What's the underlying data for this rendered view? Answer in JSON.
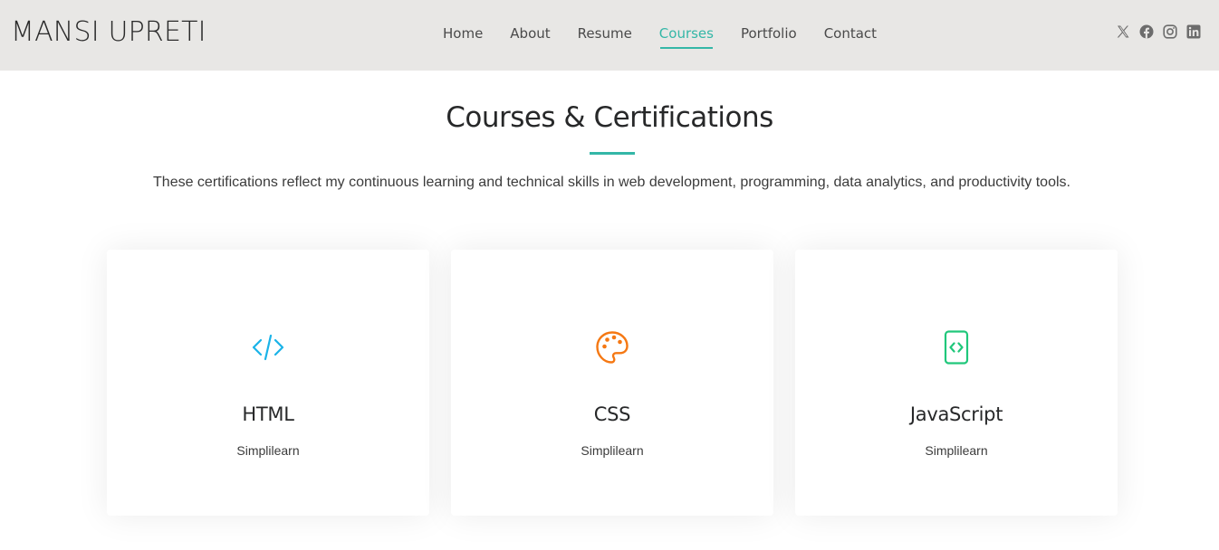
{
  "header": {
    "logo": "MANSI UPRETI",
    "nav": [
      {
        "label": "Home",
        "active": false
      },
      {
        "label": "About",
        "active": false
      },
      {
        "label": "Resume",
        "active": false
      },
      {
        "label": "Courses",
        "active": true
      },
      {
        "label": "Portfolio",
        "active": false
      },
      {
        "label": "Contact",
        "active": false
      }
    ],
    "socials": [
      "x-icon",
      "facebook-icon",
      "instagram-icon",
      "linkedin-icon"
    ]
  },
  "section": {
    "title": "Courses & Certifications",
    "description": "These certifications reflect my continuous learning and technical skills in web development, programming, data analytics, and productivity tools."
  },
  "cards": [
    {
      "title": "HTML",
      "provider": "Simplilearn",
      "icon": "code-icon",
      "icon_color": "#1ab3e8"
    },
    {
      "title": "CSS",
      "provider": "Simplilearn",
      "icon": "palette-icon",
      "icon_color": "#f57813"
    },
    {
      "title": "JavaScript",
      "provider": "Simplilearn",
      "icon": "file-code-icon",
      "icon_color": "#20c77b"
    }
  ],
  "colors": {
    "accent": "#34b7a7",
    "header_bg": "#e8e7e5",
    "social_icon": "#6c6c6c"
  }
}
